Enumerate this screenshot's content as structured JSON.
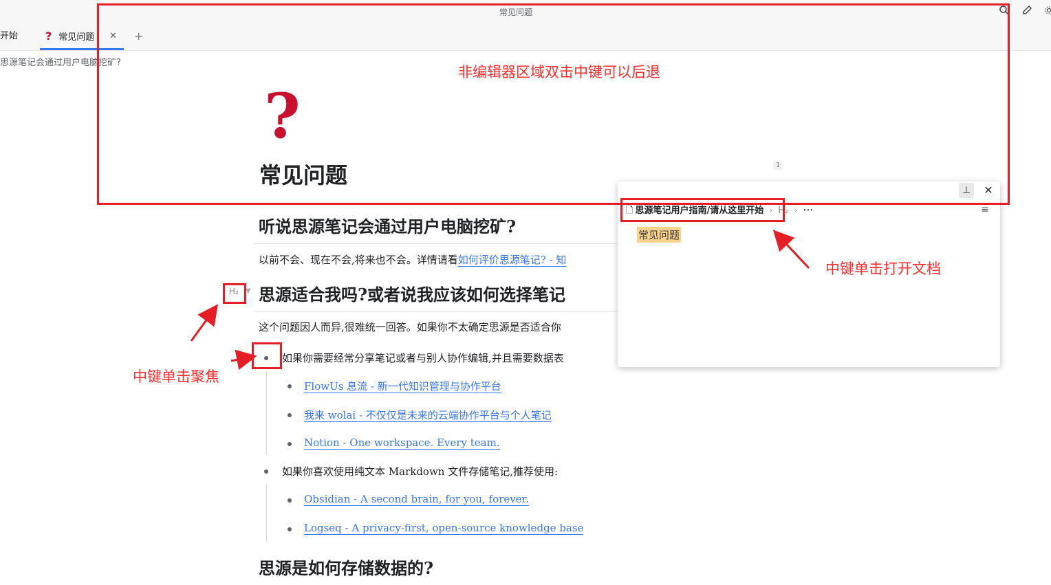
{
  "window": {
    "title": "常见问题"
  },
  "tabs": [
    {
      "label": "开始"
    },
    {
      "label": "常见问题",
      "icon": "question-icon"
    }
  ],
  "breadcrumb": "思源笔记会通过用户电脑挖矿?",
  "doc": {
    "icon": "❓",
    "title": "常见问题",
    "block_count": "1",
    "sections": [
      {
        "heading": "听说思源笔记会通过用户电脑挖矿?"
      },
      {
        "heading": "思源适合我吗?或者说我应该如何选择笔记"
      },
      {
        "heading": "思源是如何存储数据的?"
      }
    ],
    "para1_text": "以前不会、现在不会,将来也不会。详情请看",
    "para1_link": "如何评价思源笔记? - 知",
    "para2_text": "这个问题因人而异,很难统一回答。如果你不太确定思源是否适合你",
    "bullet1": "如果你需要经常分享笔记或者与别人协作编辑,并且需要数据表",
    "bullet1_links": [
      "FlowUs 息流 - 新一代知识管理与协作平台",
      "我来 wolai - 不仅仅是未来的云端协作平台与个人笔记",
      "Notion - One workspace. Every team."
    ],
    "bullet2": "如果你喜欢使用纯文本 Markdown 文件存储笔记,推荐使用:",
    "bullet2_links": [
      "Obsidian - A second brain, for you, forever.",
      "Logseq - A privacy-first, open-source knowledge base"
    ],
    "h2_marker": "H₂"
  },
  "popup": {
    "path": "思源笔记用户指南/请从这里开始",
    "crumb_h2": "H₂",
    "crumb_more": "···",
    "highlight": "常见问题"
  },
  "annotations": {
    "top": "非编辑器区域双击中键可以后退",
    "right": "中键单击打开文档",
    "left": "中键单击聚焦"
  }
}
